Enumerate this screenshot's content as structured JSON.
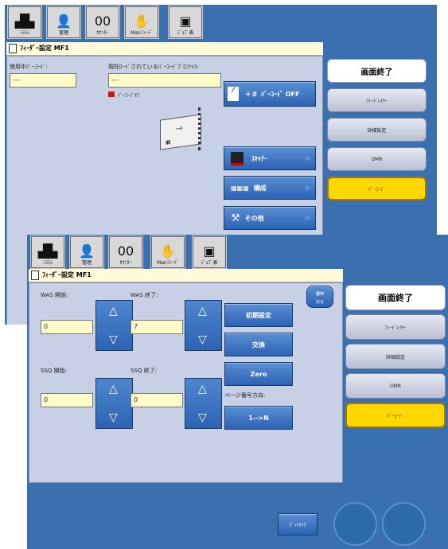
{
  "toolbar": {
    "system": "ｼｽﾃﾑ",
    "manager": "管理",
    "counter": "ｶｳﾝﾀｰ",
    "manual_feed": "Manﾌｨｰﾄﾞ",
    "job_queue": "ｼﾞｮﾌﾞ表"
  },
  "screen1": {
    "title": "ﾌｨｰﾀﾞｰ設定 MF1",
    "barcode_in_use_label": "使用中ﾊﾞｰｺｰﾄﾞ:",
    "barcode_in_use_value": "---",
    "loaded_profile_label": "現在ﾛｰﾄﾞされているﾊﾞｰｺｰﾄﾞﾌﾟﾛﾌｧｲﾙ:",
    "loaded_profile_value": "---",
    "barcode_off_indicator": "ﾊﾞｰｺｰﾄﾞｵﾌ",
    "barcode_off_button": "ﾊﾞｰｺｰﾄﾞ OFF",
    "scanner_button": "ｽｷｬﾅｰ",
    "config_button": "構成",
    "other_button": "その他",
    "side": {
      "end_screen": "画面終了",
      "feed_layer": "ﾌｨｰﾄﾞﾚｲﾔｰ",
      "detail_settings": "詳細設定",
      "omr": "OMR",
      "barcode": "ﾊﾞｰｺｰﾄﾞ"
    }
  },
  "screen2": {
    "title": "ﾌｨｰﾀﾞｰ設定 MF1",
    "back_label": "戻る",
    "was_start_label": "WAS 開始:",
    "was_start_value": "0",
    "was_end_label": "WAS 終了:",
    "was_end_value": "7",
    "ssq_start_label": "SSQ 開始:",
    "ssq_start_value": "0",
    "ssq_end_label": "SSQ 終了:",
    "ssq_end_value": "0",
    "initial_settings_button": "初期設定",
    "swap_button": "交換",
    "zero_button": "Zero",
    "page_direction_label": "ページ番号方向:",
    "page_direction_button": "1-->N",
    "deck_clear_button": "ﾃﾞｯｷｸﾘｱ",
    "side": {
      "end_screen": "画面終了",
      "feed_layer": "ﾌｨｰﾄﾞﾚｲﾔｰ",
      "detail_settings": "詳細設定",
      "omr": "OMR",
      "barcode": "ﾊﾞｰｺｰﾄﾞ"
    }
  },
  "colors": {
    "screen_bg": "#3a70b0",
    "panel_bg": "#c8d0e6",
    "field_bg": "#fdfcc8",
    "button_blue": "#2c63b3",
    "highlight_yellow": "#ffd800",
    "indicator_red": "#d01010"
  }
}
